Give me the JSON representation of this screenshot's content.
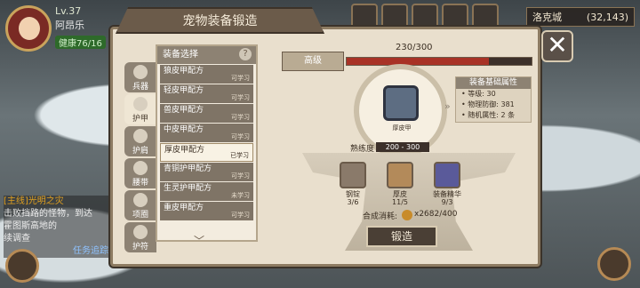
{
  "player": {
    "level": "Lv.37",
    "name": "阿昂乐",
    "hp": "健康76/16"
  },
  "location": {
    "name": "洛克城",
    "coords": "(32,143)"
  },
  "quest": {
    "title": "[主线]光明之灾",
    "lines": [
      "击败挡路的怪物，到达",
      "霍图斯高地的",
      "续调查"
    ],
    "tracker": "任务追踪"
  },
  "panel": {
    "title": "宠物装备锻造",
    "close": "✕",
    "list_header": "装备选择",
    "help": "?"
  },
  "tabs": [
    {
      "label": "兵器"
    },
    {
      "label": "护甲"
    },
    {
      "label": "护肩"
    },
    {
      "label": "腰带"
    },
    {
      "label": "项圈"
    },
    {
      "label": "护符"
    }
  ],
  "recipes": [
    {
      "name": "狼皮甲配方",
      "status": "可学习"
    },
    {
      "name": "轻皮甲配方",
      "status": "可学习"
    },
    {
      "name": "兽皮甲配方",
      "status": "可学习"
    },
    {
      "name": "中皮甲配方",
      "status": "可学习"
    },
    {
      "name": "厚皮甲配方",
      "status": "已学习"
    },
    {
      "name": "青铜护甲配方",
      "status": "可学习"
    },
    {
      "name": "生灵护甲配方",
      "status": "未学习"
    },
    {
      "name": "重皮甲配方",
      "status": "可学习"
    }
  ],
  "forge": {
    "level_label": "高级",
    "level_progress": "230/300",
    "level_fraction": 0.767,
    "item_name": "厚皮甲",
    "item_level": "Lv30",
    "attr_title": "装备基础属性",
    "attrs": [
      "• 等级: 30",
      "• 物理防御: 381",
      "• 随机属性: 2 条"
    ],
    "proficiency_label": "熟练度",
    "proficiency": "200 - 300",
    "materials": [
      {
        "name": "钢锭",
        "count": "3/6",
        "color": "#8a7a6a"
      },
      {
        "name": "厚皮",
        "count": "11/5",
        "color": "#b38a5a"
      },
      {
        "name": "装备精华",
        "count": "9/3",
        "color": "#5a5a9a"
      }
    ],
    "cost_label": "合成消耗:",
    "cost": "x2682/400",
    "button": "锻造"
  }
}
